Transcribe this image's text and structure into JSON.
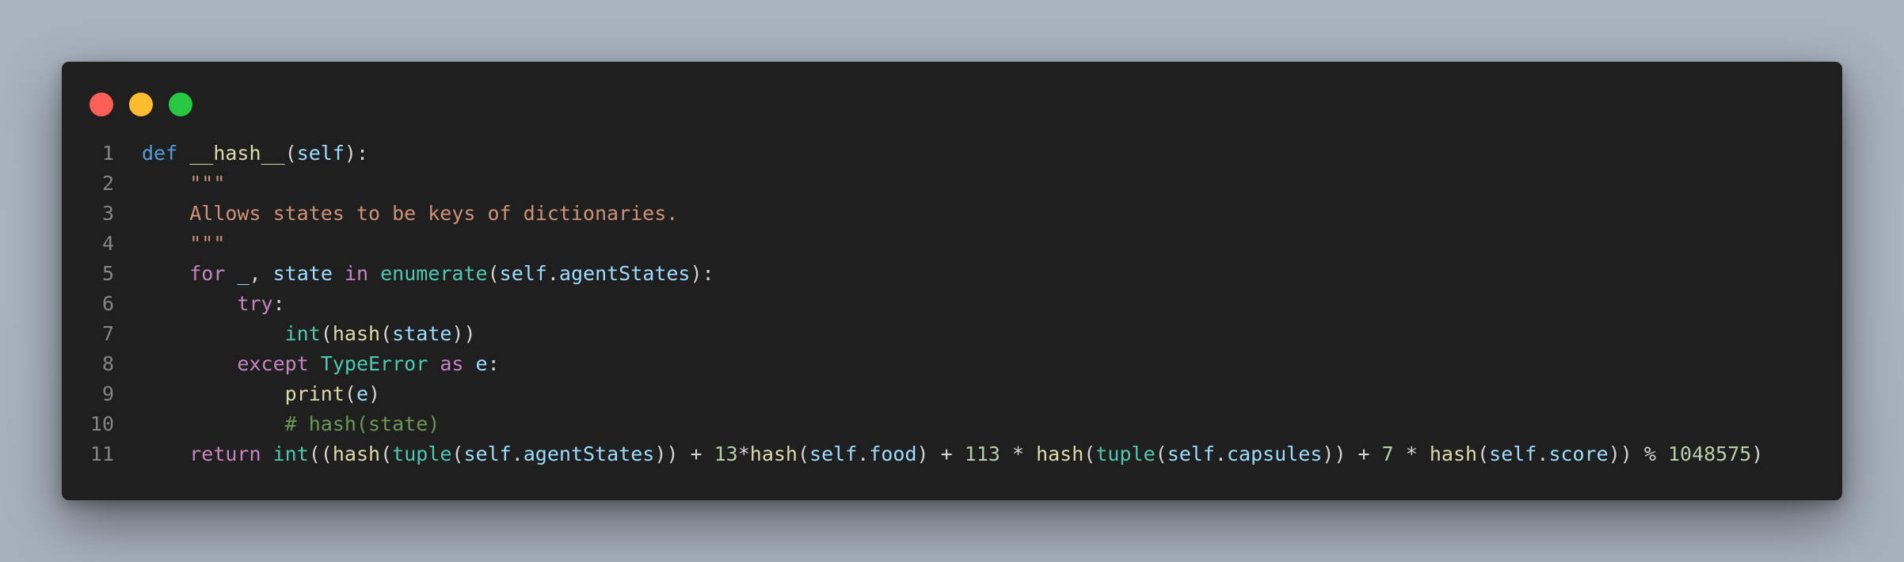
{
  "window_controls": {
    "close_color": "#ff5f57",
    "minimize_color": "#febc2e",
    "maximize_color": "#28c840"
  },
  "theme": {
    "background": "#1f1f1f",
    "page_background": "#a9b3bf"
  },
  "code": {
    "language": "python",
    "lines": [
      {
        "number": "1",
        "tokens": [
          {
            "t": "def",
            "c": "kw"
          },
          {
            "t": " ",
            "c": "op"
          },
          {
            "t": "__hash__",
            "c": "fn"
          },
          {
            "t": "(",
            "c": "op"
          },
          {
            "t": "self",
            "c": "var"
          },
          {
            "t": "):",
            "c": "op"
          }
        ]
      },
      {
        "number": "2",
        "tokens": [
          {
            "t": "    ",
            "c": "op"
          },
          {
            "t": "\"\"\"",
            "c": "str"
          }
        ]
      },
      {
        "number": "3",
        "tokens": [
          {
            "t": "    ",
            "c": "op"
          },
          {
            "t": "Allows states to be keys of dictionaries.",
            "c": "str"
          }
        ]
      },
      {
        "number": "4",
        "tokens": [
          {
            "t": "    ",
            "c": "op"
          },
          {
            "t": "\"\"\"",
            "c": "str"
          }
        ]
      },
      {
        "number": "5",
        "tokens": [
          {
            "t": "    ",
            "c": "op"
          },
          {
            "t": "for",
            "c": "kw2"
          },
          {
            "t": " ",
            "c": "op"
          },
          {
            "t": "_",
            "c": "var"
          },
          {
            "t": ", ",
            "c": "op"
          },
          {
            "t": "state",
            "c": "var"
          },
          {
            "t": " ",
            "c": "op"
          },
          {
            "t": "in",
            "c": "kw2"
          },
          {
            "t": " ",
            "c": "op"
          },
          {
            "t": "enumerate",
            "c": "bi"
          },
          {
            "t": "(",
            "c": "op"
          },
          {
            "t": "self",
            "c": "var"
          },
          {
            "t": ".",
            "c": "op"
          },
          {
            "t": "agentStates",
            "c": "var"
          },
          {
            "t": "):",
            "c": "op"
          }
        ]
      },
      {
        "number": "6",
        "tokens": [
          {
            "t": "        ",
            "c": "op"
          },
          {
            "t": "try",
            "c": "kw2"
          },
          {
            "t": ":",
            "c": "op"
          }
        ]
      },
      {
        "number": "7",
        "tokens": [
          {
            "t": "            ",
            "c": "op"
          },
          {
            "t": "int",
            "c": "bi"
          },
          {
            "t": "(",
            "c": "op"
          },
          {
            "t": "hash",
            "c": "fn"
          },
          {
            "t": "(",
            "c": "op"
          },
          {
            "t": "state",
            "c": "var"
          },
          {
            "t": "))",
            "c": "op"
          }
        ]
      },
      {
        "number": "8",
        "tokens": [
          {
            "t": "        ",
            "c": "op"
          },
          {
            "t": "except",
            "c": "kw2"
          },
          {
            "t": " ",
            "c": "op"
          },
          {
            "t": "TypeError",
            "c": "bi"
          },
          {
            "t": " ",
            "c": "op"
          },
          {
            "t": "as",
            "c": "kw2"
          },
          {
            "t": " ",
            "c": "op"
          },
          {
            "t": "e",
            "c": "var"
          },
          {
            "t": ":",
            "c": "op"
          }
        ]
      },
      {
        "number": "9",
        "tokens": [
          {
            "t": "            ",
            "c": "op"
          },
          {
            "t": "print",
            "c": "fn"
          },
          {
            "t": "(",
            "c": "op"
          },
          {
            "t": "e",
            "c": "var"
          },
          {
            "t": ")",
            "c": "op"
          }
        ]
      },
      {
        "number": "10",
        "tokens": [
          {
            "t": "            ",
            "c": "op"
          },
          {
            "t": "# hash(state)",
            "c": "cm"
          }
        ]
      },
      {
        "number": "11",
        "tokens": [
          {
            "t": "    ",
            "c": "op"
          },
          {
            "t": "return",
            "c": "kw2"
          },
          {
            "t": " ",
            "c": "op"
          },
          {
            "t": "int",
            "c": "bi"
          },
          {
            "t": "((",
            "c": "op"
          },
          {
            "t": "hash",
            "c": "fn"
          },
          {
            "t": "(",
            "c": "op"
          },
          {
            "t": "tuple",
            "c": "bi"
          },
          {
            "t": "(",
            "c": "op"
          },
          {
            "t": "self",
            "c": "var"
          },
          {
            "t": ".",
            "c": "op"
          },
          {
            "t": "agentStates",
            "c": "var"
          },
          {
            "t": ")) + ",
            "c": "op"
          },
          {
            "t": "13",
            "c": "num"
          },
          {
            "t": "*",
            "c": "op"
          },
          {
            "t": "hash",
            "c": "fn"
          },
          {
            "t": "(",
            "c": "op"
          },
          {
            "t": "self",
            "c": "var"
          },
          {
            "t": ".",
            "c": "op"
          },
          {
            "t": "food",
            "c": "var"
          },
          {
            "t": ") + ",
            "c": "op"
          },
          {
            "t": "113",
            "c": "num"
          },
          {
            "t": " * ",
            "c": "op"
          },
          {
            "t": "hash",
            "c": "fn"
          },
          {
            "t": "(",
            "c": "op"
          },
          {
            "t": "tuple",
            "c": "bi"
          },
          {
            "t": "(",
            "c": "op"
          },
          {
            "t": "self",
            "c": "var"
          },
          {
            "t": ".",
            "c": "op"
          },
          {
            "t": "capsules",
            "c": "var"
          },
          {
            "t": ")) + ",
            "c": "op"
          },
          {
            "t": "7",
            "c": "num"
          },
          {
            "t": " * ",
            "c": "op"
          },
          {
            "t": "hash",
            "c": "fn"
          },
          {
            "t": "(",
            "c": "op"
          },
          {
            "t": "self",
            "c": "var"
          },
          {
            "t": ".",
            "c": "op"
          },
          {
            "t": "score",
            "c": "var"
          },
          {
            "t": ")) % ",
            "c": "op"
          },
          {
            "t": "1048575",
            "c": "num"
          },
          {
            "t": ")",
            "c": "op"
          }
        ]
      }
    ]
  }
}
